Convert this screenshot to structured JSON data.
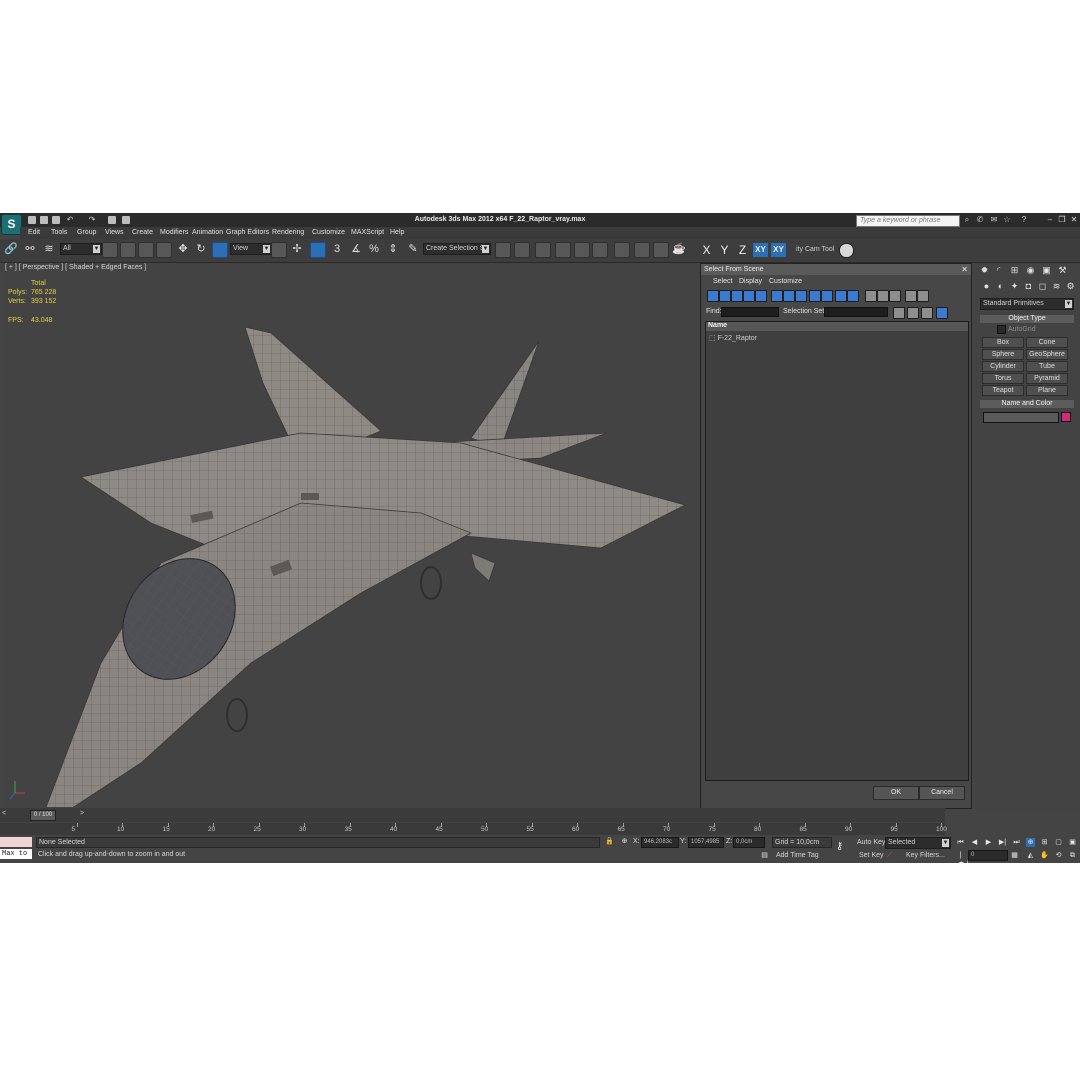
{
  "app": {
    "title": "Autodesk 3ds Max  2012 x64     F_22_Raptor_vray.max",
    "logo_icon": "3dsmax-logo-icon",
    "search_placeholder": "Type a keyword or phrase"
  },
  "menu": [
    "Edit",
    "Tools",
    "Group",
    "Views",
    "Create",
    "Modifiers",
    "Animation",
    "Graph Editors",
    "Rendering",
    "Customize",
    "MAXScript",
    "Help"
  ],
  "toolbar": {
    "selection_filter": "All",
    "ref_coord": "View",
    "named_selection": "Create Selection Se",
    "axes": [
      "X",
      "Y",
      "Z",
      "XY",
      "XY"
    ],
    "cam_tool": "ity Cam Tool"
  },
  "viewport": {
    "label": "[ + ] [ Perspective ] [ Shaded + Edged Faces ]",
    "stats": {
      "header": "Total",
      "polys_label": "Polys:",
      "polys_value": "765 228",
      "verts_label": "Verts:",
      "verts_value": "393 152",
      "fps_label": "FPS:",
      "fps_value": "43.048"
    }
  },
  "dialog": {
    "title": "Select From Scene",
    "menu": [
      "Select",
      "Display",
      "Customize"
    ],
    "find_label": "Find:",
    "find_value": "",
    "selset_label": "Selection Set:",
    "selset_value": "",
    "column_header": "Name",
    "items": [
      "F-22_Raptor"
    ],
    "ok_label": "OK",
    "cancel_label": "Cancel"
  },
  "command_panel": {
    "category": "Standard Primitives",
    "object_type_title": "Object Type",
    "autogrid_label": "AutoGrid",
    "primitives": [
      "Box",
      "Cone",
      "Sphere",
      "GeoSphere",
      "Cylinder",
      "Tube",
      "Torus",
      "Pyramid",
      "Teapot",
      "Plane"
    ],
    "name_color_title": "Name and Color",
    "object_color": "#d4287b"
  },
  "timeline": {
    "position": "0 / 100",
    "ticks": [
      "5",
      "10",
      "15",
      "20",
      "25",
      "30",
      "35",
      "40",
      "45",
      "50",
      "55",
      "60",
      "65",
      "70",
      "75",
      "80",
      "85",
      "90",
      "95",
      "100"
    ]
  },
  "status": {
    "maxscript_value": "Max to",
    "selection": "None Selected",
    "prompt": "Click and drag up-and-down to zoom in and out",
    "x_label": "X:",
    "x_value": "946,2083c",
    "y_label": "Y:",
    "y_value": "1057,4985",
    "z_label": "Z:",
    "z_value": "0,0cm",
    "grid": "Grid = 10,0cm",
    "add_time_tag": "Add Time Tag",
    "auto_key": "Auto Key",
    "auto_key_mode": "Selected",
    "set_key": "Set Key",
    "key_filters": "Key Filters...",
    "current_frame": "0"
  }
}
